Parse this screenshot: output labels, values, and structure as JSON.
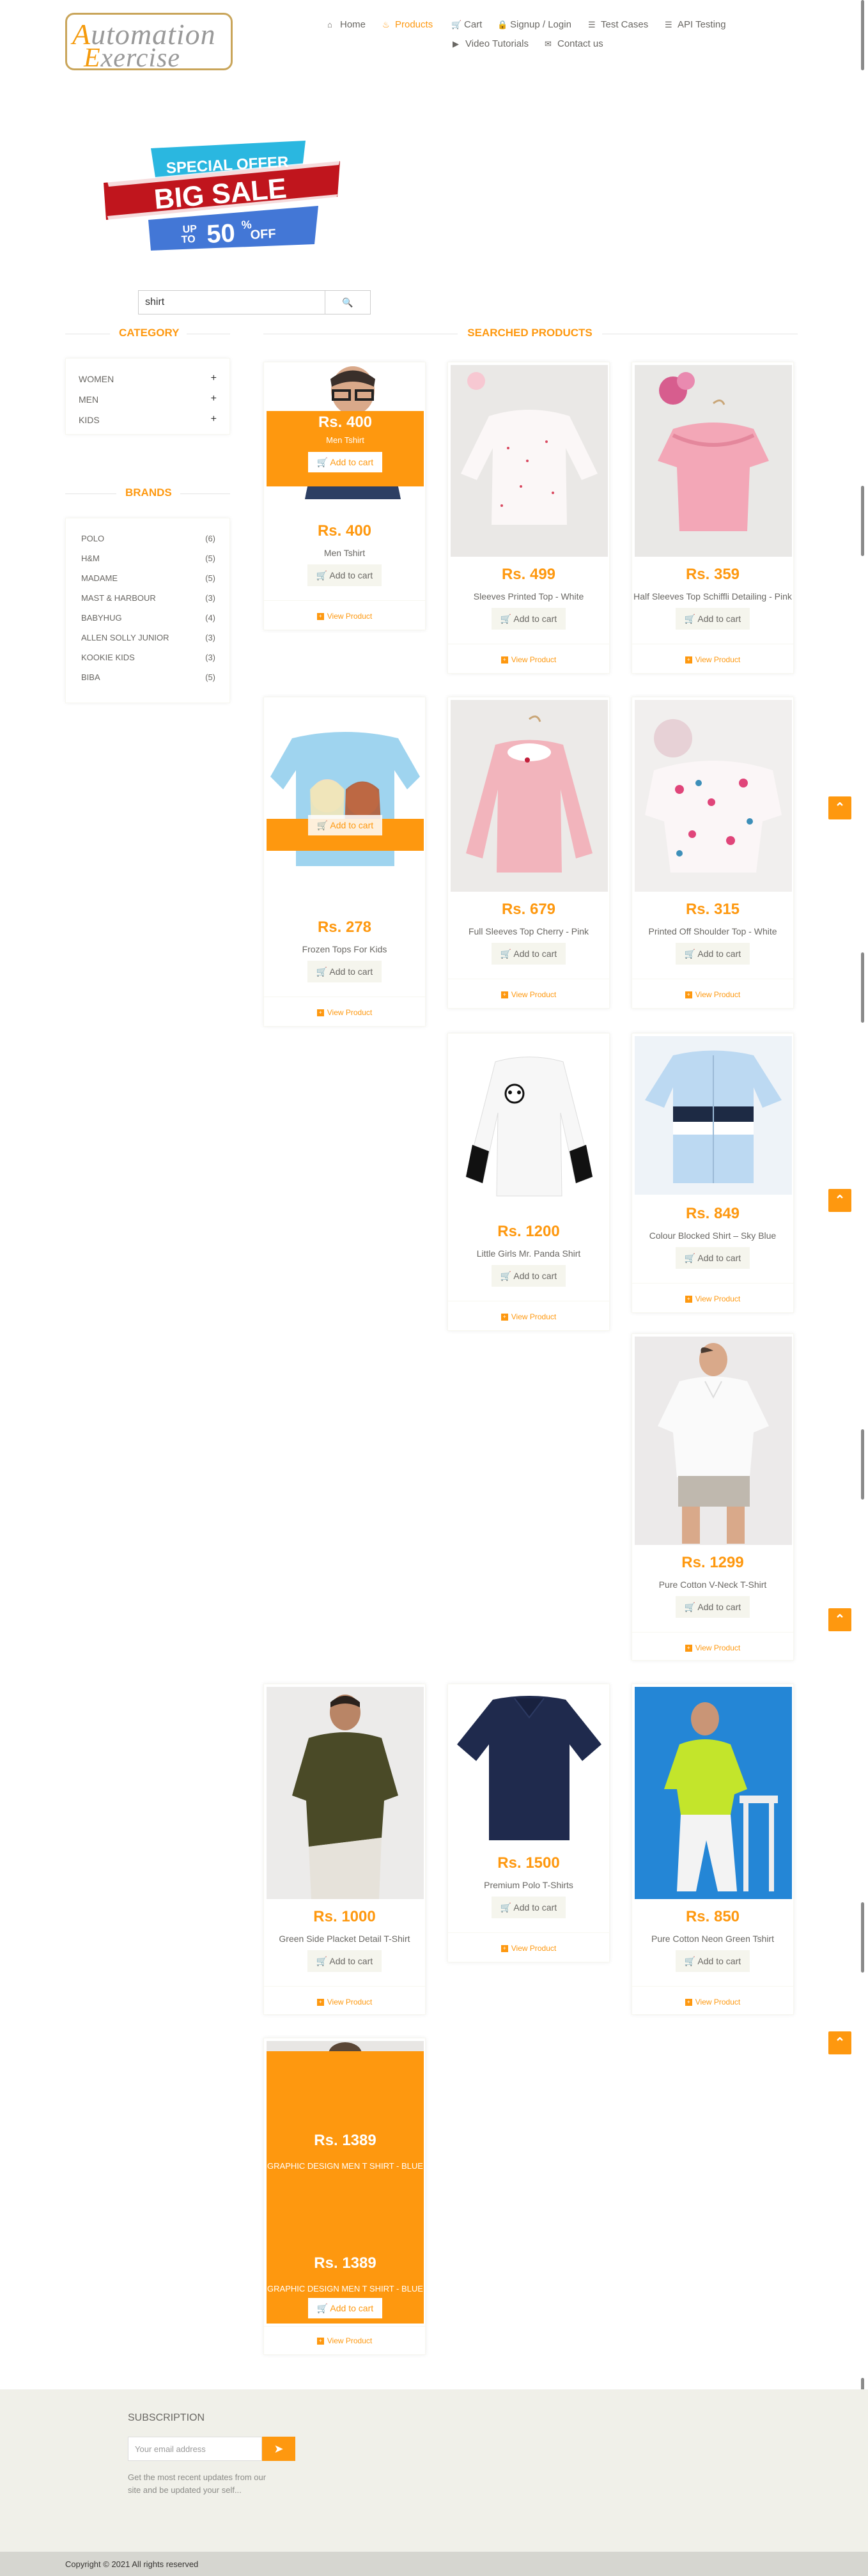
{
  "header": {
    "logo_top": "utomation",
    "logo_top_cap": "A",
    "logo_bottom": "xercise",
    "logo_bottom_cap": "E",
    "nav": [
      {
        "label": "Home",
        "icon": "home-icon"
      },
      {
        "label": "Products",
        "icon": "products-icon",
        "active": true
      },
      {
        "label": "Cart",
        "icon": "cart-icon"
      },
      {
        "label": "Signup / Login",
        "icon": "lock-icon"
      },
      {
        "label": "Test Cases",
        "icon": "list-icon"
      },
      {
        "label": "API Testing",
        "icon": "list-icon"
      },
      {
        "label": "Video Tutorials",
        "icon": "youtube-icon"
      },
      {
        "label": "Contact us",
        "icon": "envelope-icon"
      }
    ]
  },
  "banner": {
    "line1": "SPECIAL OFFER",
    "line2": "BIG SALE",
    "line3a": "UP",
    "line3b": "TO",
    "line3c": "50",
    "line3d": "%",
    "line3e": "OFF"
  },
  "search": {
    "value": "shirt",
    "button_icon": "search-icon"
  },
  "sidebar": {
    "category_title": "CATEGORY",
    "categories": [
      "WOMEN",
      "MEN",
      "KIDS"
    ],
    "brands_title": "BRANDS",
    "brands": [
      {
        "name": "POLO",
        "count": "(6)"
      },
      {
        "name": "H&M",
        "count": "(5)"
      },
      {
        "name": "MADAME",
        "count": "(5)"
      },
      {
        "name": "MAST & HARBOUR",
        "count": "(3)"
      },
      {
        "name": "BABYHUG",
        "count": "(4)"
      },
      {
        "name": "ALLEN SOLLY JUNIOR",
        "count": "(3)"
      },
      {
        "name": "KOOKIE KIDS",
        "count": "(3)"
      },
      {
        "name": "BIBA",
        "count": "(5)"
      }
    ]
  },
  "products_title": "SEARCHED PRODUCTS",
  "add_to_cart": "Add to cart",
  "view_product": "View Product",
  "products": [
    {
      "price": "Rs. 400",
      "name": "Men Tshirt"
    },
    {
      "price": "Rs. 499",
      "name": "Sleeves Printed Top - White"
    },
    {
      "price": "Rs. 359",
      "name": "Half Sleeves Top Schiffli Detailing - Pink"
    },
    {
      "price": "Rs. 278",
      "name": "Frozen Tops For Kids"
    },
    {
      "price": "Rs. 679",
      "name": "Full Sleeves Top Cherry - Pink"
    },
    {
      "price": "Rs. 315",
      "name": "Printed Off Shoulder Top - White"
    },
    {
      "price": "Rs. 1200",
      "name": "Little Girls Mr. Panda Shirt"
    },
    {
      "price": "Rs. 849",
      "name": "Colour Blocked Shirt – Sky Blue"
    },
    {
      "price": "Rs. 1299",
      "name": "Pure Cotton V-Neck T-Shirt"
    },
    {
      "price": "Rs. 1000",
      "name": "Green Side Placket Detail T-Shirt"
    },
    {
      "price": "Rs. 1500",
      "name": "Premium Polo T-Shirts"
    },
    {
      "price": "Rs. 850",
      "name": "Pure Cotton Neon Green Tshirt"
    },
    {
      "price": "Rs. 1389",
      "name": "GRAPHIC DESIGN MEN T SHIRT - BLUE"
    }
  ],
  "footer": {
    "subscription_title": "SUBSCRIPTION",
    "email_placeholder": "Your email address",
    "subscribe_text": "Get the most recent updates from our site and be updated your self...",
    "copyright": "Copyright © 2021 All rights reserved"
  },
  "colors": {
    "accent": "#fe980f",
    "text": "#696763",
    "footer_bg": "#f0f0e9"
  }
}
